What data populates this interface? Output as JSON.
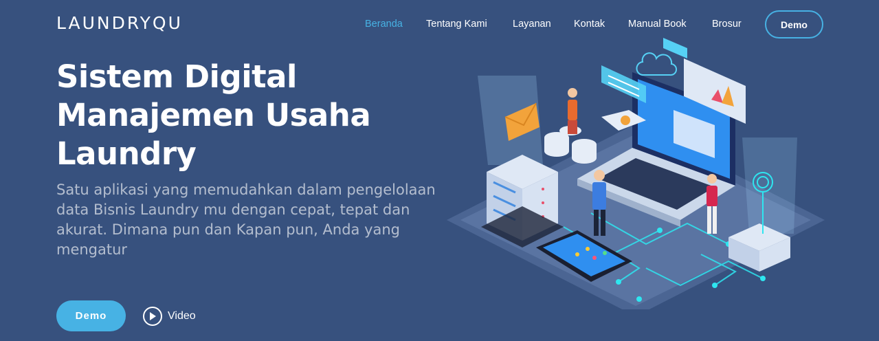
{
  "brand": {
    "logo_text": "LAUNDRYQU"
  },
  "nav": {
    "items": [
      {
        "label": "Beranda",
        "active": true
      },
      {
        "label": "Tentang Kami"
      },
      {
        "label": "Layanan"
      },
      {
        "label": "Kontak"
      },
      {
        "label": "Manual Book"
      },
      {
        "label": "Brosur"
      }
    ],
    "cta_label": "Demo"
  },
  "hero": {
    "title_lines": [
      "Sistem Digital",
      "Manajemen Usaha",
      "Laundry"
    ],
    "subtitle": "Satu aplikasi yang memudahkan dalam pengelolaan data Bisnis Laundry mu dengan cepat, tepat dan akurat. Dimana pun dan Kapan pun, Anda yang mengatur",
    "primary_button": "Demo",
    "video_button": "Video",
    "illustration_icon": "isometric-laptop-illustration"
  },
  "colors": {
    "background": "#37517e",
    "accent": "#47b2e4",
    "text": "#ffffff"
  }
}
